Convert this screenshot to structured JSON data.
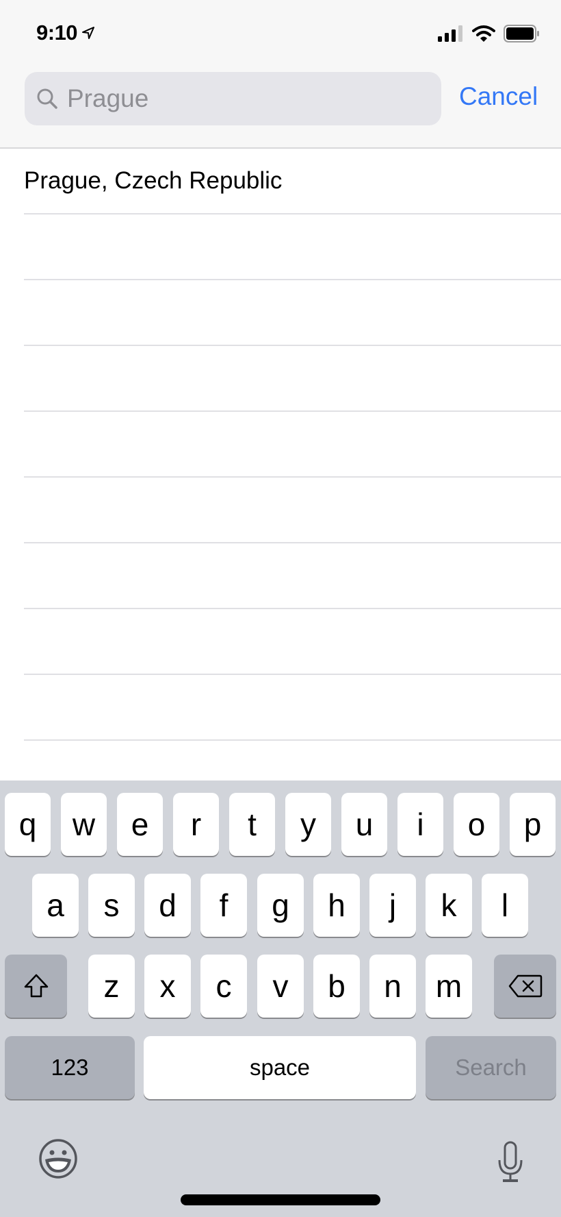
{
  "status_bar": {
    "time": "9:10",
    "icons": [
      "location-arrow-icon",
      "cellular-signal-icon",
      "wifi-icon",
      "battery-icon"
    ]
  },
  "search": {
    "placeholder": "Prague",
    "value": "",
    "cancel_label": "Cancel",
    "accent_color": "#3478f6"
  },
  "results": [
    {
      "label": "Prague, Czech Republic"
    },
    {
      "label": ""
    },
    {
      "label": ""
    },
    {
      "label": ""
    },
    {
      "label": ""
    },
    {
      "label": ""
    },
    {
      "label": ""
    },
    {
      "label": ""
    },
    {
      "label": ""
    }
  ],
  "keyboard": {
    "row1": [
      "q",
      "w",
      "e",
      "r",
      "t",
      "y",
      "u",
      "i",
      "o",
      "p"
    ],
    "row2": [
      "a",
      "s",
      "d",
      "f",
      "g",
      "h",
      "j",
      "k",
      "l"
    ],
    "row3": [
      "z",
      "x",
      "c",
      "v",
      "b",
      "n",
      "m"
    ],
    "numbers_label": "123",
    "space_label": "space",
    "search_label": "Search",
    "shift_icon": "shift-icon",
    "delete_icon": "delete-icon",
    "emoji_icon": "emoji-icon",
    "mic_icon": "microphone-icon"
  }
}
